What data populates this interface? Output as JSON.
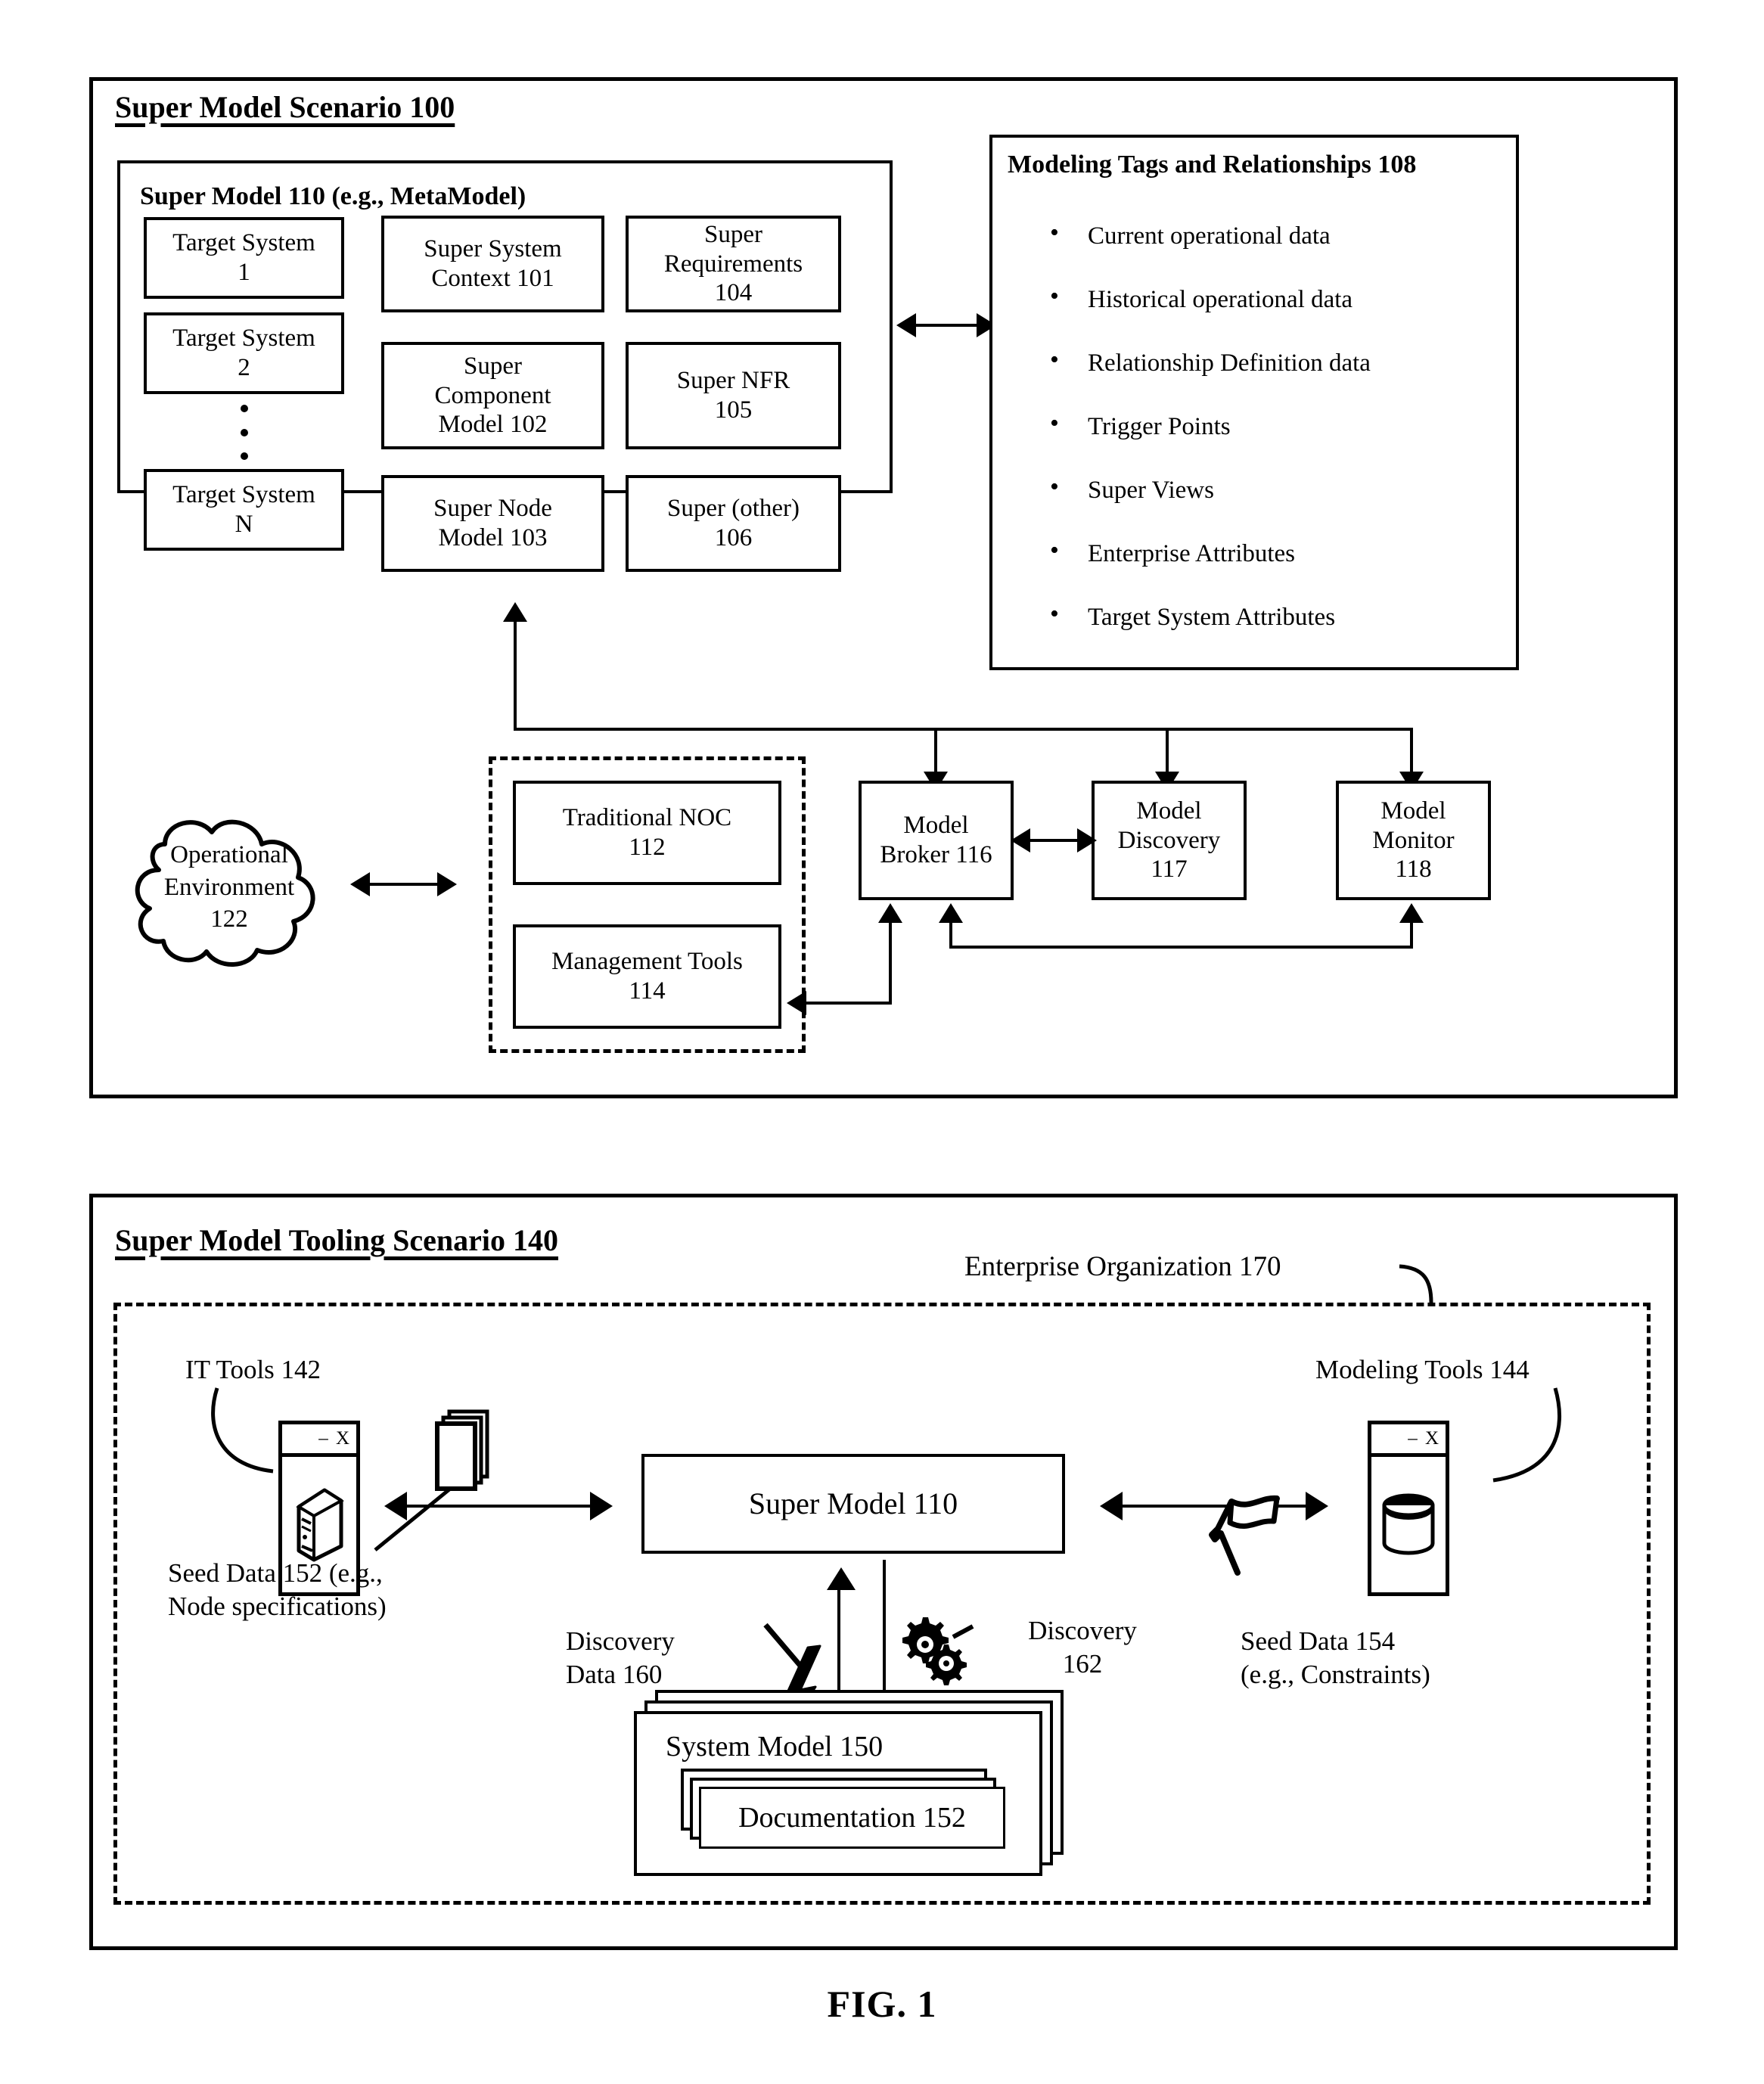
{
  "figure": {
    "caption": "FIG. 1"
  },
  "scenario_100": {
    "title": "Super Model Scenario 100",
    "super_model": {
      "title": "Super Model 110 (e.g., MetaModel)",
      "target_systems": [
        "Target System\n1",
        "Target System\n2",
        "Target System\nN"
      ],
      "ellipsis_icon": "vertical-ellipsis",
      "middle_column": [
        "Super System\nContext 101",
        "Super\nComponent\nModel 102",
        "Super Node\nModel 103"
      ],
      "right_column": [
        "Super\nRequirements\n104",
        "Super NFR\n105",
        "Super (other)\n106"
      ]
    },
    "modeling_tags": {
      "title": "Modeling Tags and Relationships 108",
      "items": [
        "Current operational data",
        "Historical operational data",
        "Relationship Definition data",
        "Trigger Points",
        "Super Views",
        "Enterprise Attributes",
        "Target System Attributes"
      ]
    },
    "operational_environment": "Operational\nEnvironment\n122",
    "tools_group": [
      "Traditional NOC\n112",
      "Management Tools\n114"
    ],
    "services": [
      "Model\nBroker 116",
      "Model\nDiscovery\n117",
      "Model\nMonitor\n118"
    ]
  },
  "scenario_140": {
    "title": "Super Model Tooling Scenario 140",
    "enterprise_org_label": "Enterprise Organization 170",
    "it_tools_label": "IT Tools 142",
    "it_tools_window": {
      "controls": "– X",
      "icon": "computer-tower-icon"
    },
    "modeling_tools_label": "Modeling Tools 144",
    "modeling_tools_window": {
      "controls": "– X",
      "icon": "database-cylinder-icon"
    },
    "seed_data_152": "Seed Data 152 (e.g.,\nNode specifications)",
    "seed_data_152_icon": "document-stack-icon",
    "seed_data_154": "Seed Data 154\n(e.g., Constraints)",
    "seed_data_154_icon": "flag-icon",
    "super_model_box": "Super Model 110",
    "discovery_data_160": "Discovery\nData 160",
    "discovery_data_160_icon": "lightning-bolt-icon",
    "discovery_162": "Discovery\n162",
    "discovery_162_icon": "gears-icon",
    "system_model_150": "System Model 150",
    "documentation_152": "Documentation 152"
  }
}
